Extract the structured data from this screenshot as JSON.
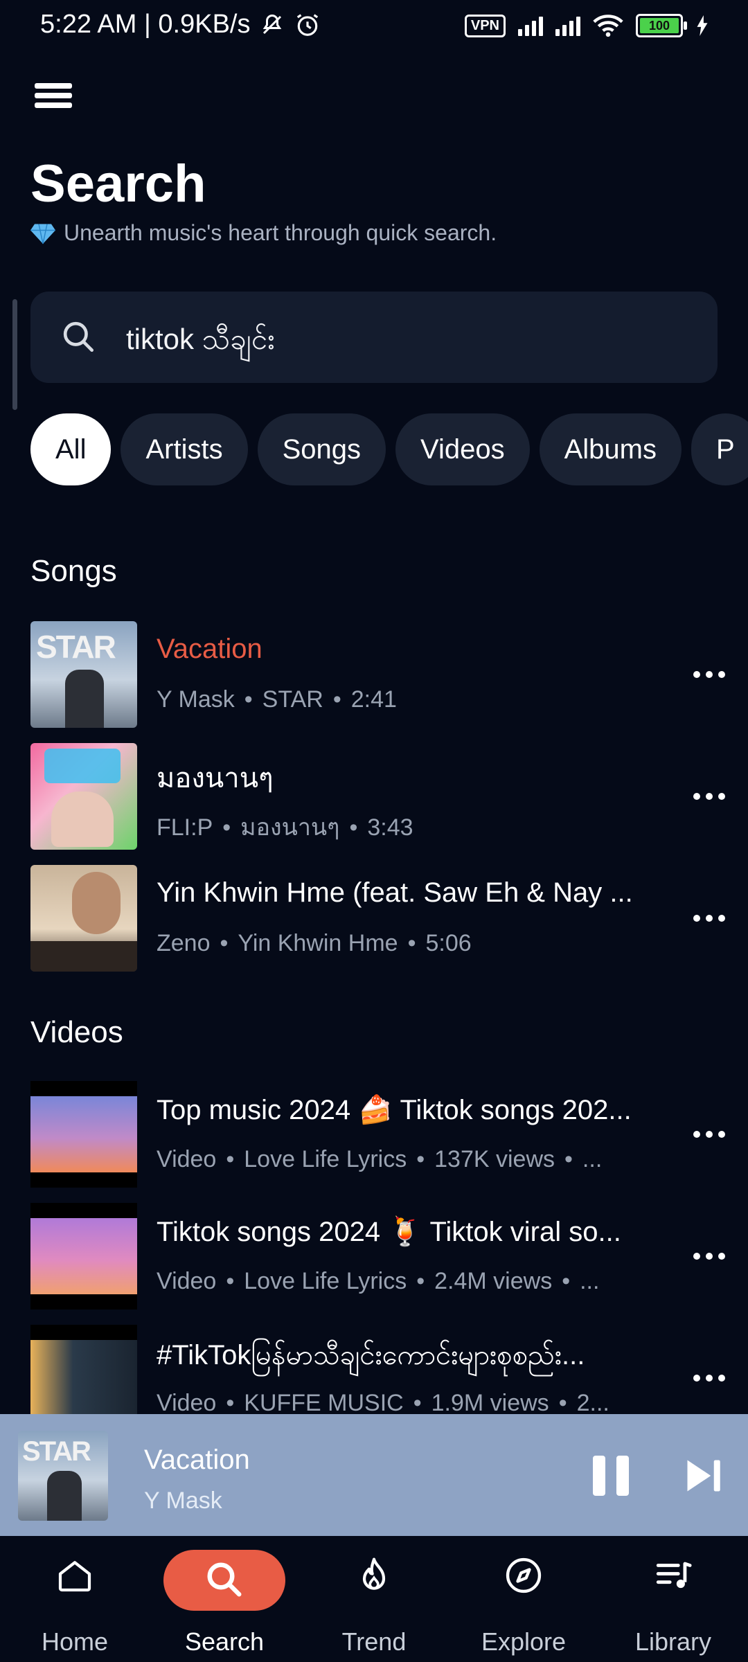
{
  "status_bar": {
    "left_text": "5:22 AM | 0.9KB/s",
    "vpn_label": "VPN",
    "battery": "100"
  },
  "page": {
    "title": "Search",
    "subtitle": "Unearth music's heart through quick search."
  },
  "search": {
    "value": "tiktok သီချင်း",
    "placeholder": ""
  },
  "chips": [
    {
      "label": "All",
      "active": true
    },
    {
      "label": "Artists"
    },
    {
      "label": "Songs"
    },
    {
      "label": "Videos"
    },
    {
      "label": "Albums"
    },
    {
      "label": "P"
    }
  ],
  "songs_section": {
    "title": "Songs",
    "items": [
      {
        "title": "Vacation",
        "artist": "Y Mask",
        "album": "STAR",
        "duration": "2:41",
        "playing": true
      },
      {
        "title": "มองนานๆ",
        "artist": "FLI:P",
        "album": "มองนานๆ",
        "duration": "3:43"
      },
      {
        "title": "Yin Khwin Hme (feat. Saw Eh & Nay ...",
        "artist": "Zeno",
        "album": "Yin Khwin Hme",
        "duration": "5:06"
      }
    ]
  },
  "videos_section": {
    "title": "Videos",
    "items": [
      {
        "title": "Top music 2024 🍰 Tiktok songs 202...",
        "type": "Video",
        "channel": "Love Life Lyrics",
        "views": "137K views",
        "extra": "..."
      },
      {
        "title": "Tiktok songs 2024 🍹 Tiktok viral so...",
        "type": "Video",
        "channel": "Love Life Lyrics",
        "views": "2.4M views",
        "extra": "..."
      },
      {
        "title": "#TikTokမြန်မာသီချင်းကောင်းများစုစည်း...",
        "type": "Video",
        "channel": "KUFFE MUSIC",
        "views": "1.9M views",
        "extra": "2..."
      }
    ]
  },
  "mini_player": {
    "title": "Vacation",
    "artist": "Y Mask"
  },
  "bottom_nav": [
    {
      "label": "Home",
      "icon": "home-icon"
    },
    {
      "label": "Search",
      "icon": "search-icon",
      "active": true
    },
    {
      "label": "Trend",
      "icon": "flame-icon"
    },
    {
      "label": "Explore",
      "icon": "compass-icon"
    },
    {
      "label": "Library",
      "icon": "library-icon"
    }
  ],
  "colors": {
    "background": "#050a18",
    "accent": "#e85c45",
    "surface": "#141c2e",
    "player": "#8ea3c4"
  }
}
